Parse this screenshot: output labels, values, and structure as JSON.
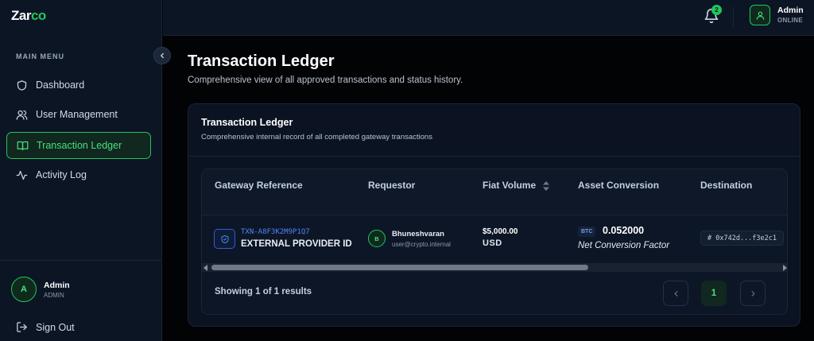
{
  "app": {
    "logo_main": "Zar",
    "logo_accent": "co",
    "accent_color": "#22c55e"
  },
  "sidebar": {
    "menu_label": "MAIN MENU",
    "items": [
      {
        "label": "Dashboard",
        "icon": "shield-icon"
      },
      {
        "label": "User Management",
        "icon": "users-icon"
      },
      {
        "label": "Transaction Ledger",
        "icon": "book-icon",
        "active": true
      },
      {
        "label": "Activity Log",
        "icon": "activity-icon"
      }
    ],
    "user": {
      "initial": "A",
      "name": "Admin",
      "role": "ADMIN"
    },
    "sign_out": "Sign Out"
  },
  "topbar": {
    "notifications": 2,
    "user": {
      "name": "Admin",
      "status": "ONLINE"
    }
  },
  "page": {
    "title": "Transaction Ledger",
    "subtitle": "Comprehensive view of all approved transactions and status history."
  },
  "card": {
    "title": "Transaction Ledger",
    "subtitle": "Comprehensive internal record of all completed gateway transactions"
  },
  "table": {
    "columns": [
      "Gateway Reference",
      "Requestor",
      "Fiat Volume",
      "Asset Conversion",
      "Destination"
    ],
    "rows": [
      {
        "txn_id": "TXN-A8F3K2M9P1Q7",
        "txn_sub": "EXTERNAL PROVIDER ID",
        "requestor_initial": "B",
        "requestor_name": "Bhuneshvaran",
        "requestor_email": "user@crypto.internal",
        "fiat_amount": "$5,000.00",
        "fiat_currency": "USD",
        "asset_symbol": "BTC",
        "asset_amount": "0.052000",
        "asset_note": "Net Conversion Factor",
        "destination": "# 0x742d...f3e2c1"
      }
    ]
  },
  "footer": {
    "showing": "Showing 1 of 1 results",
    "current_page": "1"
  }
}
